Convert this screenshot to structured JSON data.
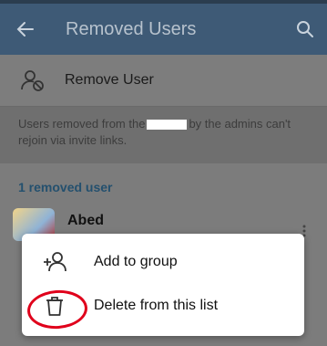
{
  "app_bar": {
    "title": "Removed Users",
    "icons": {
      "back": "arrow-left-icon",
      "search": "search-icon"
    }
  },
  "remove_user": {
    "label": "Remove User",
    "icon": "remove-user-icon"
  },
  "info": {
    "text_before": "Users removed from the",
    "text_after": "by the admins can't rejoin via invite links."
  },
  "list": {
    "header": "1 removed user",
    "users": [
      {
        "name": "Abed"
      }
    ]
  },
  "context_menu": {
    "items": [
      {
        "label": "Add to group",
        "icon": "add-user-icon"
      },
      {
        "label": "Delete from this list",
        "icon": "trash-icon"
      }
    ]
  },
  "colors": {
    "app_bar": "#3e5a76",
    "accent_header": "#24506e",
    "annotation": "#e0001b"
  }
}
